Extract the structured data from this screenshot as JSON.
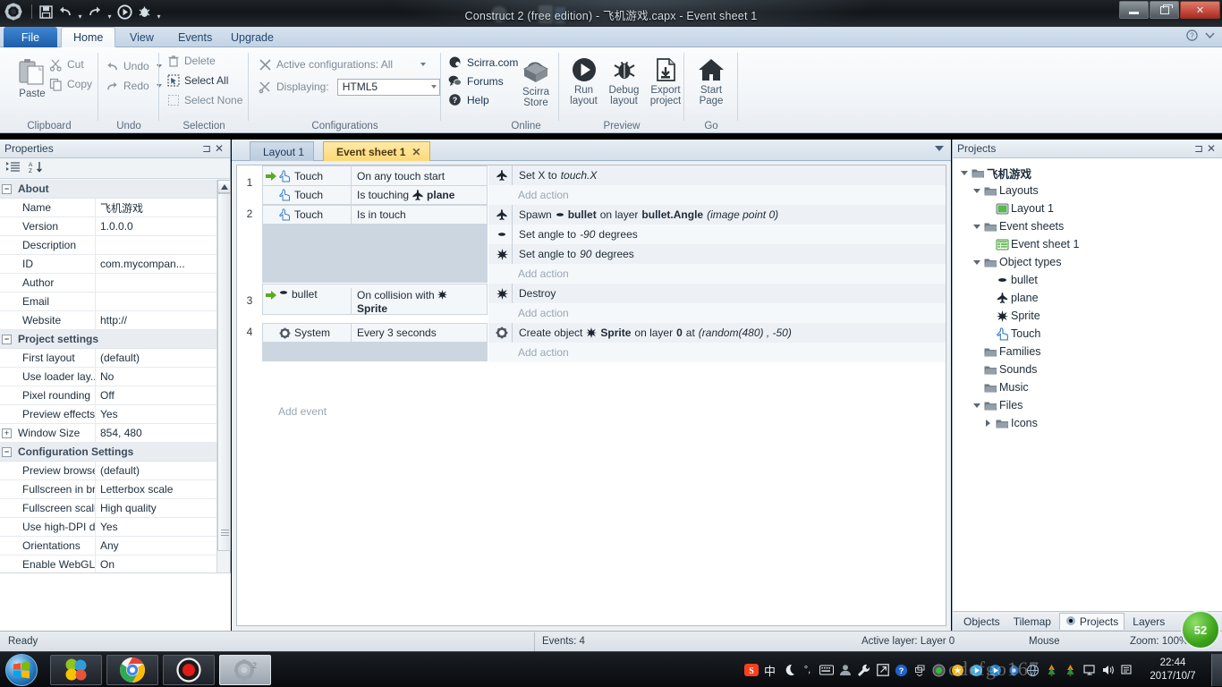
{
  "window": {
    "title": "Construct 2  (free edition) - 飞机游戏.capx - Event sheet 1",
    "minimize_label": "Minimize",
    "maximize_label": "Restore",
    "close_label": "✕"
  },
  "ribbon": {
    "tabs": [
      {
        "id": "file",
        "label": "File"
      },
      {
        "id": "home",
        "label": "Home"
      },
      {
        "id": "view",
        "label": "View"
      },
      {
        "id": "events",
        "label": "Events"
      },
      {
        "id": "upgrade",
        "label": "Upgrade"
      }
    ],
    "active_tab": "Home",
    "groups": {
      "clipboard": {
        "label": "Clipboard",
        "paste": "Paste",
        "cut": "Cut",
        "copy": "Copy"
      },
      "undo": {
        "label": "Undo",
        "undo": "Undo",
        "redo": "Redo"
      },
      "selection": {
        "label": "Selection",
        "delete": "Delete",
        "select_all": "Select All",
        "select_none": "Select None"
      },
      "configurations": {
        "label": "Configurations",
        "active_configurations_label": "Active configurations: All",
        "displaying_label": "Displaying:",
        "displaying_value": "HTML5"
      },
      "online": {
        "label": "Online",
        "scirra_com": "Scirra.com",
        "forums": "Forums",
        "help": "Help",
        "scirra_store": "Scirra\nStore",
        "scirra_store_line1": "Scirra",
        "scirra_store_line2": "Store"
      },
      "preview": {
        "label": "Preview",
        "run_layout_line1": "Run",
        "run_layout_line2": "layout",
        "debug_layout_line1": "Debug",
        "debug_layout_line2": "layout",
        "export_project_line1": "Export",
        "export_project_line2": "project"
      },
      "go": {
        "label": "Go",
        "start_page_line1": "Start",
        "start_page_line2": "Page"
      }
    }
  },
  "properties": {
    "title": "Properties",
    "sections": [
      {
        "name": "About",
        "rows": [
          {
            "name": "Name",
            "value": "飞机游戏"
          },
          {
            "name": "Version",
            "value": "1.0.0.0"
          },
          {
            "name": "Description",
            "value": ""
          },
          {
            "name": "ID",
            "value": "com.mycompan..."
          },
          {
            "name": "Author",
            "value": ""
          },
          {
            "name": "Email",
            "value": ""
          },
          {
            "name": "Website",
            "value": "http://"
          }
        ]
      },
      {
        "name": "Project settings",
        "rows": [
          {
            "name": "First layout",
            "value": "(default)"
          },
          {
            "name": "Use loader lay...",
            "value": "No"
          },
          {
            "name": "Pixel rounding",
            "value": "Off"
          },
          {
            "name": "Preview effects",
            "value": "Yes"
          },
          {
            "name": "Window Size",
            "value": "854, 480",
            "expandable": true
          }
        ]
      },
      {
        "name": "Configuration Settings",
        "rows": [
          {
            "name": "Preview browser",
            "value": "(default)"
          },
          {
            "name": "Fullscreen in br...",
            "value": "Letterbox scale"
          },
          {
            "name": "Fullscreen scali...",
            "value": "High quality"
          },
          {
            "name": "Use high-DPI di...",
            "value": "Yes"
          },
          {
            "name": "Orientations",
            "value": "Any"
          },
          {
            "name": "Enable WebGL",
            "value": "On"
          }
        ]
      }
    ]
  },
  "document_tabs": {
    "layout_tab": "Layout 1",
    "event_sheet_tab": "Event sheet 1",
    "close_label": "✕"
  },
  "event_sheet": {
    "add_event_label": "Add event",
    "add_action_label": "Add action",
    "events": [
      {
        "number": "1",
        "conditions": [
          {
            "object": "Touch",
            "icon": "touch-icon",
            "text": "On any touch start",
            "trigger": true
          },
          {
            "object": "Touch",
            "icon": "touch-icon",
            "text": "Is touching",
            "param": "plane",
            "param_icon": "plane-icon"
          }
        ],
        "actions": [
          {
            "icon": "plane-icon",
            "text": "Set X to ",
            "expr": "touch.X"
          }
        ]
      },
      {
        "number": "2",
        "conditions": [
          {
            "object": "Touch",
            "icon": "touch-icon",
            "text": "Is in touch"
          }
        ],
        "actions": [
          {
            "icon": "plane-icon",
            "text": "Spawn",
            "obj_icon": "bullet-icon",
            "obj": "bullet",
            "mid": "on layer",
            "bold2": "bullet.Angle",
            "tail": "(image point 0)"
          },
          {
            "icon": "bullet-icon",
            "text": "Set angle to ",
            "expr": "-90",
            "tail2": " degrees"
          },
          {
            "icon": "sprite-icon",
            "text": "Set angle to ",
            "expr": "90",
            "tail2": " degrees"
          }
        ]
      },
      {
        "number": "3",
        "conditions": [
          {
            "object": "bullet",
            "icon": "bullet-icon",
            "text": "On collision with",
            "param": "Sprite",
            "param_icon": "sprite-icon",
            "trigger": true
          }
        ],
        "actions": [
          {
            "icon": "sprite-icon",
            "text": "Destroy"
          }
        ]
      },
      {
        "number": "4",
        "conditions": [
          {
            "object": "System",
            "icon": "system-icon",
            "text": "Every 3 seconds"
          }
        ],
        "actions": [
          {
            "icon": "system-icon",
            "text": "Create object",
            "obj_icon": "sprite-icon",
            "obj": "Sprite",
            "mid": "on layer",
            "bold2": "0",
            "mid2": "at",
            "tail": "(random(480) , -50)"
          }
        ]
      }
    ]
  },
  "projects": {
    "title": "Projects",
    "tree": [
      {
        "label": "飞机游戏",
        "depth": 0,
        "icon": "folder-icon",
        "expander": "open",
        "bold": true
      },
      {
        "label": "Layouts",
        "depth": 1,
        "icon": "folder-icon",
        "expander": "open"
      },
      {
        "label": "Layout 1",
        "depth": 2,
        "icon": "layout-icon"
      },
      {
        "label": "Event sheets",
        "depth": 1,
        "icon": "folder-icon",
        "expander": "open"
      },
      {
        "label": "Event sheet 1",
        "depth": 2,
        "icon": "eventsheet-icon"
      },
      {
        "label": "Object types",
        "depth": 1,
        "icon": "folder-icon",
        "expander": "open"
      },
      {
        "label": "bullet",
        "depth": 2,
        "icon": "bullet-icon"
      },
      {
        "label": "plane",
        "depth": 2,
        "icon": "plane-icon"
      },
      {
        "label": "Sprite",
        "depth": 2,
        "icon": "sprite-icon"
      },
      {
        "label": "Touch",
        "depth": 2,
        "icon": "touch-icon"
      },
      {
        "label": "Families",
        "depth": 1,
        "icon": "folder-icon"
      },
      {
        "label": "Sounds",
        "depth": 1,
        "icon": "folder-icon"
      },
      {
        "label": "Music",
        "depth": 1,
        "icon": "folder-icon"
      },
      {
        "label": "Files",
        "depth": 1,
        "icon": "folder-icon",
        "expander": "open"
      },
      {
        "label": "Icons",
        "depth": 2,
        "icon": "folder-icon",
        "expander": "closed"
      }
    ],
    "bottom_tabs": [
      {
        "label": "Objects",
        "selected": false
      },
      {
        "label": "Tilemap",
        "selected": false
      },
      {
        "label": "Projects",
        "selected": true
      },
      {
        "label": "Layers",
        "selected": false
      }
    ]
  },
  "status_bar": {
    "ready": "Ready",
    "events": "Events: 4",
    "active_layer": "Active layer: Layer 0",
    "mouse": "Mouse",
    "zoom": "Zoom: 100%",
    "badge": "52"
  },
  "taskbar": {
    "start_label": "Start",
    "items": [
      {
        "name": "colorful-app",
        "pinned": true
      },
      {
        "name": "chrome-browser",
        "pinned": true
      },
      {
        "name": "recorder-app",
        "pinned": true
      },
      {
        "name": "construct2-app",
        "active": true
      }
    ],
    "tray": {
      "ime_label": "中",
      "time": "22:44",
      "date": "2017/10/7"
    },
    "watermark": "cdefgo167"
  }
}
